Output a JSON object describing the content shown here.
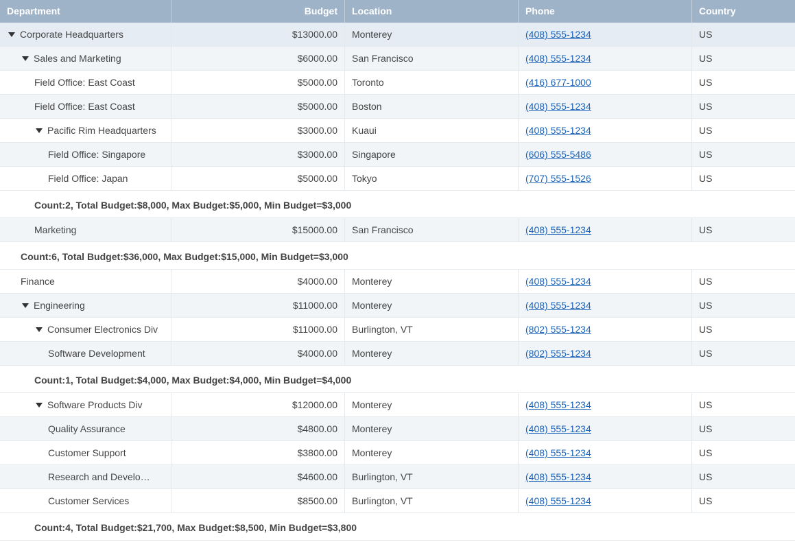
{
  "columns": {
    "department": "Department",
    "budget": "Budget",
    "location": "Location",
    "phone": "Phone",
    "country": "Country"
  },
  "rows": [
    {
      "name": "Corporate Headquarters",
      "budget": "$13000.00",
      "location": "Monterey",
      "phone": "(408) 555-1234",
      "country": "US"
    },
    {
      "name": "Sales and Marketing",
      "budget": "$6000.00",
      "location": "San Francisco",
      "phone": "(408) 555-1234",
      "country": "US"
    },
    {
      "name": "Field Office: East Coast",
      "budget": "$5000.00",
      "location": "Toronto",
      "phone": "(416) 677-1000",
      "country": "US"
    },
    {
      "name": "Field Office: East Coast",
      "budget": "$5000.00",
      "location": "Boston",
      "phone": "(408) 555-1234",
      "country": "US"
    },
    {
      "name": "Pacific Rim Headquarters",
      "budget": "$3000.00",
      "location": "Kuaui",
      "phone": "(408) 555-1234",
      "country": "US"
    },
    {
      "name": "Field Office: Singapore",
      "budget": "$3000.00",
      "location": "Singapore",
      "phone": "(606) 555-5486",
      "country": "US"
    },
    {
      "name": "Field Office: Japan",
      "budget": "$5000.00",
      "location": "Tokyo",
      "phone": "(707) 555-1526",
      "country": "US"
    },
    {
      "summary": "Count:2, Total Budget:$8,000, Max Budget:$5,000, Min Budget=$3,000"
    },
    {
      "name": "Marketing",
      "budget": "$15000.00",
      "location": "San Francisco",
      "phone": "(408) 555-1234",
      "country": "US"
    },
    {
      "summary": "Count:6, Total Budget:$36,000, Max Budget:$15,000, Min Budget=$3,000"
    },
    {
      "name": "Finance",
      "budget": "$4000.00",
      "location": "Monterey",
      "phone": "(408) 555-1234",
      "country": "US"
    },
    {
      "name": "Engineering",
      "budget": "$11000.00",
      "location": "Monterey",
      "phone": "(408) 555-1234",
      "country": "US"
    },
    {
      "name": "Consumer Electronics Div",
      "budget": "$11000.00",
      "location": "Burlington, VT",
      "phone": "(802) 555-1234",
      "country": "US"
    },
    {
      "name": "Software Development",
      "budget": "$4000.00",
      "location": "Monterey",
      "phone": "(802) 555-1234",
      "country": "US"
    },
    {
      "summary": "Count:1, Total Budget:$4,000, Max Budget:$4,000, Min Budget=$4,000"
    },
    {
      "name": "Software Products Div",
      "budget": "$12000.00",
      "location": "Monterey",
      "phone": "(408) 555-1234",
      "country": "US"
    },
    {
      "name": "Quality Assurance",
      "budget": "$4800.00",
      "location": "Monterey",
      "phone": "(408) 555-1234",
      "country": "US"
    },
    {
      "name": "Customer Support",
      "budget": "$3800.00",
      "location": "Monterey",
      "phone": "(408) 555-1234",
      "country": "US"
    },
    {
      "name": "Research and Develo…",
      "budget": "$4600.00",
      "location": "Burlington, VT",
      "phone": "(408) 555-1234",
      "country": "US"
    },
    {
      "name": "Customer Services",
      "budget": "$8500.00",
      "location": "Burlington, VT",
      "phone": "(408) 555-1234",
      "country": "US"
    },
    {
      "summary": "Count:4, Total Budget:$21,700, Max Budget:$8,500, Min Budget=$3,800"
    }
  ]
}
